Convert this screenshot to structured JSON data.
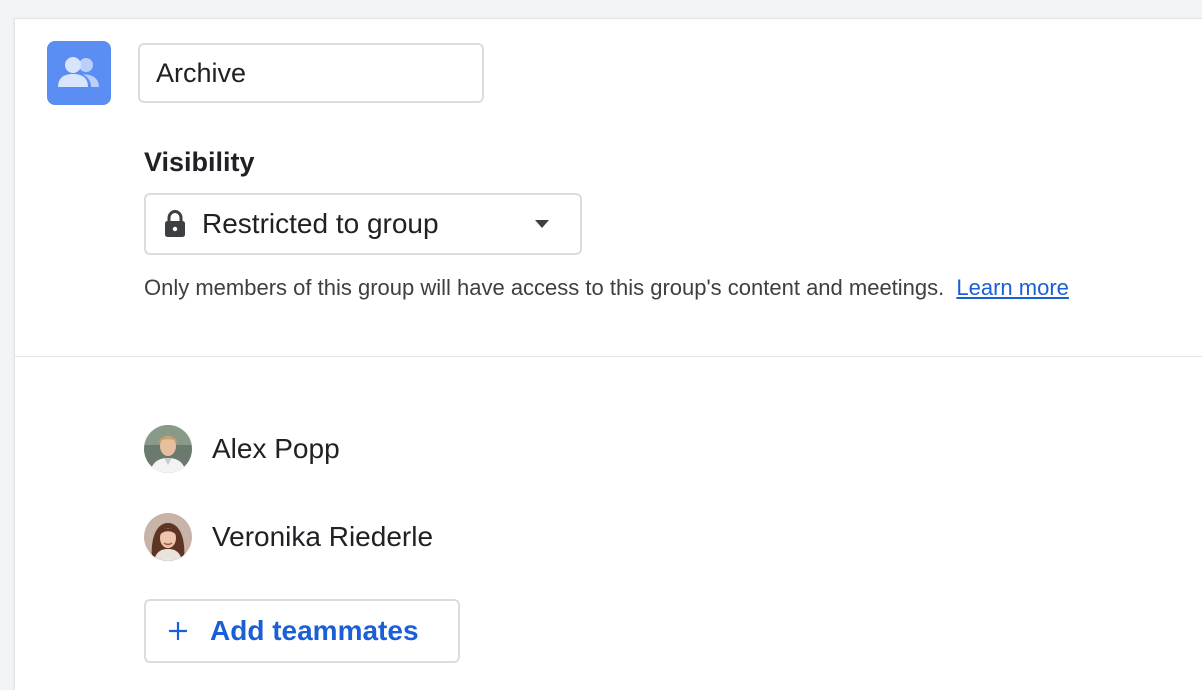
{
  "group": {
    "icon": "group-people-icon",
    "icon_color": "#5b8ef2",
    "name_value": "Archive"
  },
  "visibility": {
    "label": "Visibility",
    "selected": "Restricted to group",
    "lock_icon": "lock-icon",
    "caret_icon": "caret-down-icon",
    "help_text": "Only members of this group will have access to this group's content and meetings.",
    "learn_more": "Learn more"
  },
  "members": [
    {
      "name": "Alex Popp"
    },
    {
      "name": "Veronika Riederle"
    }
  ],
  "add_button": {
    "label": "Add teammates",
    "icon": "plus-icon",
    "color": "#1a5fd6"
  }
}
